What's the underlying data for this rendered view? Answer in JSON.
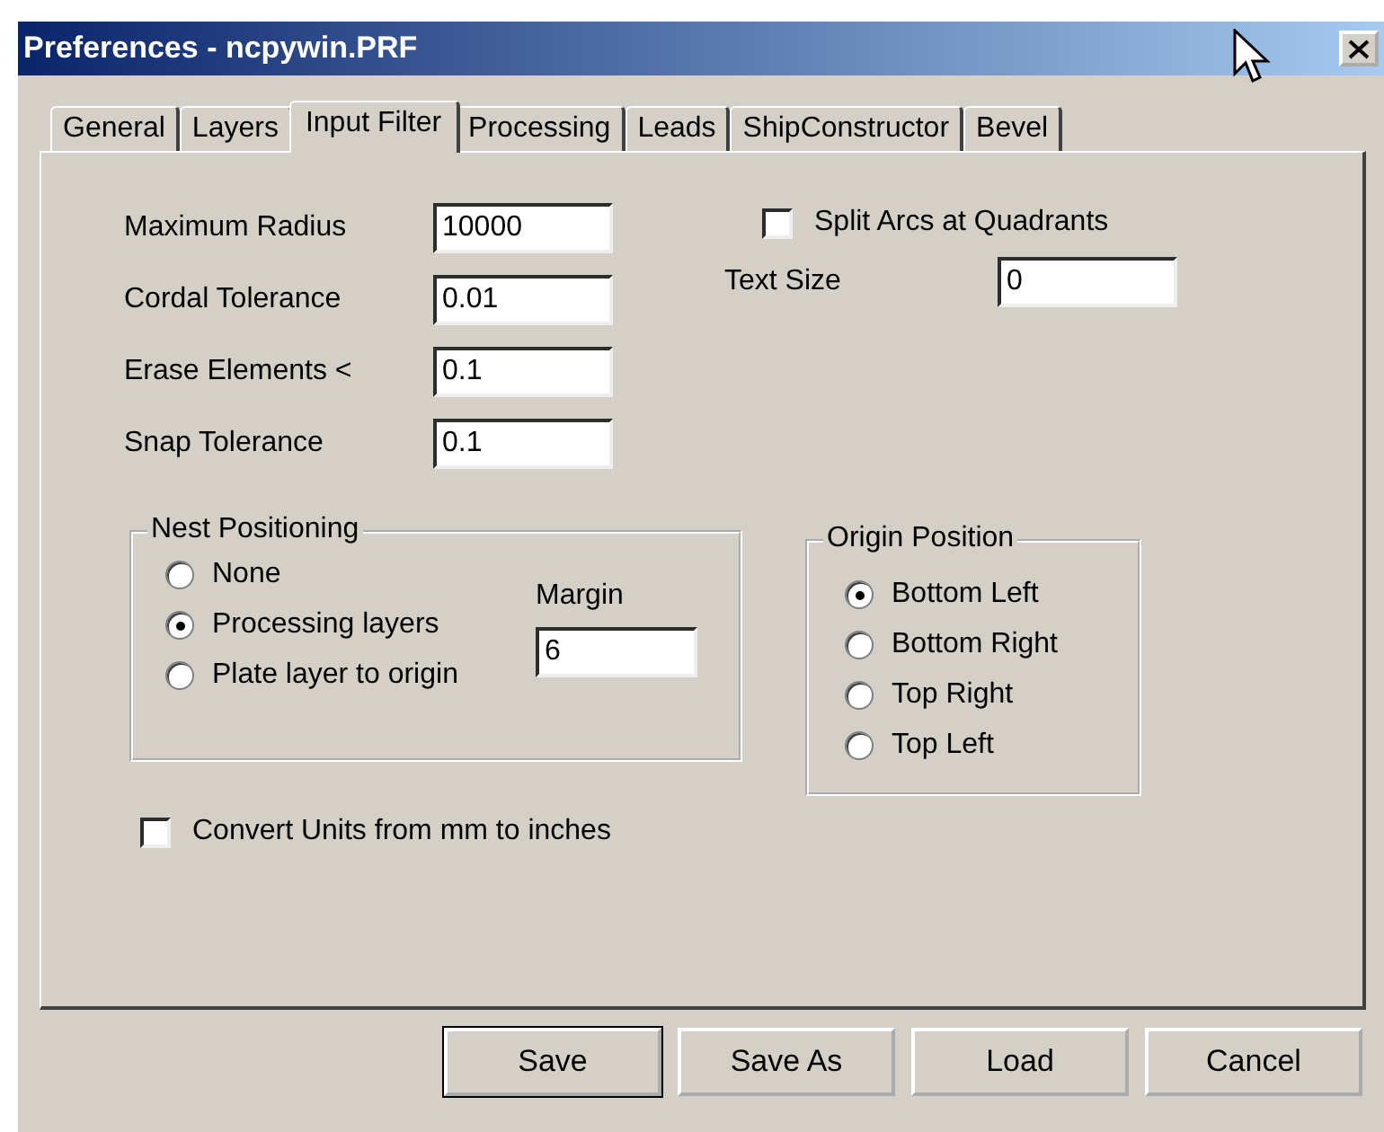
{
  "window": {
    "title": "Preferences - ncpywin.PRF"
  },
  "tabs": [
    {
      "label": "General",
      "selected": false
    },
    {
      "label": "Layers",
      "selected": false
    },
    {
      "label": "Input Filter",
      "selected": true
    },
    {
      "label": "Processing",
      "selected": false
    },
    {
      "label": "Leads",
      "selected": false
    },
    {
      "label": "ShipConstructor",
      "selected": false
    },
    {
      "label": "Bevel",
      "selected": false
    }
  ],
  "fields": [
    {
      "label": "Maximum Radius",
      "value": "10000"
    },
    {
      "label": "Cordal Tolerance",
      "value": "0.01"
    },
    {
      "label": "Erase Elements <",
      "value": "0.1"
    },
    {
      "label": "Snap Tolerance",
      "value": "0.1"
    }
  ],
  "split_arcs": {
    "label": "Split Arcs at Quadrants",
    "checked": false
  },
  "text_size": {
    "label": "Text Size",
    "value": "0"
  },
  "nest_positioning": {
    "title": "Nest Positioning",
    "options": [
      {
        "label": "None",
        "selected": false
      },
      {
        "label": "Processing layers",
        "selected": true
      },
      {
        "label": "Plate layer to origin",
        "selected": false
      }
    ],
    "margin": {
      "label": "Margin",
      "value": "6"
    }
  },
  "origin_position": {
    "title": "Origin Position",
    "options": [
      {
        "label": "Bottom Left",
        "selected": true
      },
      {
        "label": "Bottom Right",
        "selected": false
      },
      {
        "label": "Top Right",
        "selected": false
      },
      {
        "label": "Top Left",
        "selected": false
      }
    ]
  },
  "convert_units": {
    "label": "Convert Units from mm to inches",
    "checked": false
  },
  "buttons": [
    {
      "label": "Save",
      "default": true
    },
    {
      "label": "Save As",
      "default": false
    },
    {
      "label": "Load",
      "default": false
    },
    {
      "label": "Cancel",
      "default": false
    }
  ]
}
